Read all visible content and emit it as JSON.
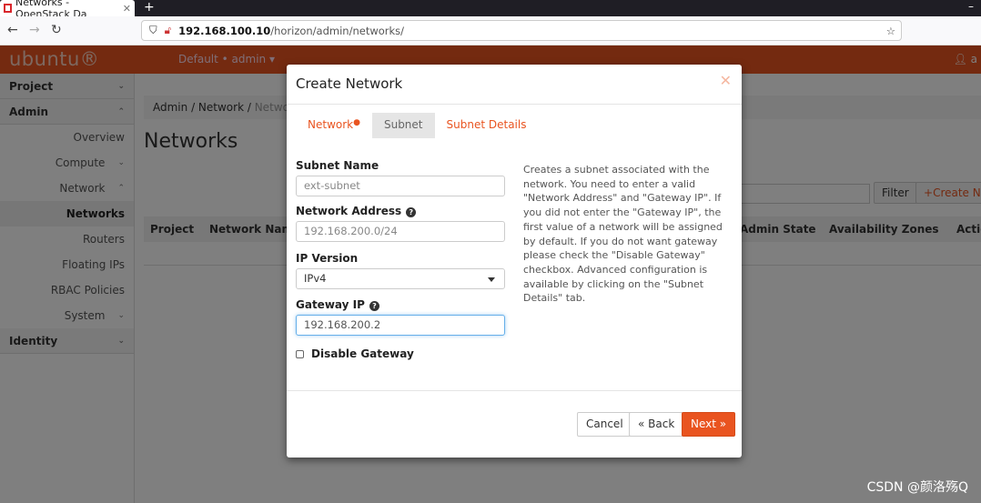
{
  "browser": {
    "tab_title": "Networks - OpenStack Da",
    "url_host": "192.168.100.10",
    "url_path": "/horizon/admin/networks/"
  },
  "header": {
    "logo": "ubuntu®",
    "project": "Default • admin ▾",
    "user": "a"
  },
  "sidebar": {
    "items": [
      {
        "label": "Project",
        "type": "section"
      },
      {
        "label": "Admin",
        "type": "section"
      },
      {
        "label": "Overview"
      },
      {
        "label": "Compute"
      },
      {
        "label": "Network"
      },
      {
        "label": "Networks",
        "active": true
      },
      {
        "label": "Routers"
      },
      {
        "label": "Floating IPs"
      },
      {
        "label": "RBAC Policies"
      },
      {
        "label": "System"
      },
      {
        "label": "Identity",
        "type": "section"
      }
    ]
  },
  "main": {
    "breadcrumb": [
      "Admin",
      "Network",
      "Networks"
    ],
    "title": "Networks",
    "filter_label": "Filter",
    "create_label": "Create Net",
    "columns": [
      "Project",
      "Network Name",
      "Admin State",
      "Availability Zones",
      "Actio"
    ]
  },
  "modal": {
    "title": "Create Network",
    "tabs": [
      "Network",
      "Subnet",
      "Subnet Details"
    ],
    "subnet_name_label": "Subnet Name",
    "subnet_name_value": "ext-subnet",
    "network_address_label": "Network Address",
    "network_address_value": "192.168.200.0/24",
    "ip_version_label": "IP Version",
    "ip_version_value": "IPv4",
    "gateway_label": "Gateway IP",
    "gateway_value": "192.168.200.2",
    "disable_gateway_label": "Disable Gateway",
    "help": "Creates a subnet associated with the network. You need to enter a valid \"Network Address\" and \"Gateway IP\". If you did not enter the \"Gateway IP\", the first value of a network will be assigned by default. If you do not want gateway please check the \"Disable Gateway\" checkbox. Advanced configuration is available by clicking on the \"Subnet Details\" tab.",
    "cancel": "Cancel",
    "back": "« Back",
    "next": "Next »"
  },
  "watermark": "CSDN @颜洛殇Q",
  "colors": {
    "accent": "#e95420"
  }
}
